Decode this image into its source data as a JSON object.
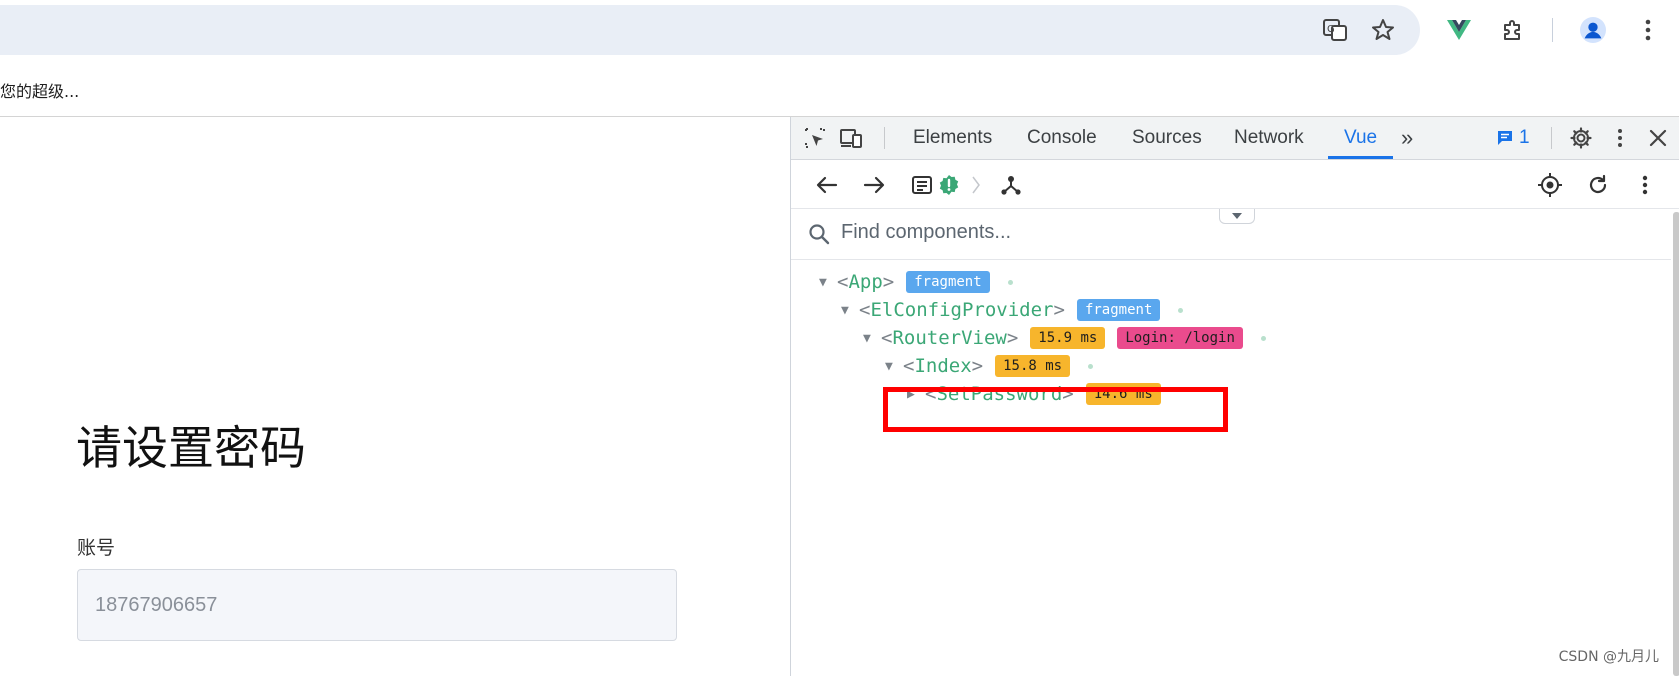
{
  "browser": {
    "bookmark_text": "您的超级...",
    "notification_count": "1"
  },
  "page": {
    "title": "请设置密码",
    "account_label": "账号",
    "account_value": "18767906657"
  },
  "devtools": {
    "tabs": [
      "Elements",
      "Console",
      "Sources",
      "Network",
      "Vue"
    ],
    "active_tab": "Vue",
    "more_tabs_glyph": "»",
    "issues_count": "1",
    "search_placeholder": "Find components...",
    "tree": [
      {
        "name": "App",
        "badges": [
          {
            "type": "fragment",
            "text": "fragment"
          }
        ]
      },
      {
        "name": "ElConfigProvider",
        "badges": [
          {
            "type": "fragment",
            "text": "fragment"
          }
        ]
      },
      {
        "name": "RouterView",
        "badges": [
          {
            "type": "time",
            "text": "15.9 ms"
          },
          {
            "type": "route",
            "text": "Login: /login"
          }
        ]
      },
      {
        "name": "Index",
        "badges": [
          {
            "type": "time",
            "text": "15.8 ms"
          }
        ]
      },
      {
        "name": "SetPassword",
        "badges": [
          {
            "type": "time",
            "text": "14.6 ms"
          }
        ]
      }
    ]
  },
  "watermark": "CSDN @九月儿",
  "colors": {
    "vue_green": "#3ba776",
    "active_tab_blue": "#1a73e8",
    "highlight_red": "#ff0000",
    "badge_fragment": "#5aa7ee",
    "badge_time": "#f7b52c",
    "badge_route": "#ea4b8d"
  }
}
